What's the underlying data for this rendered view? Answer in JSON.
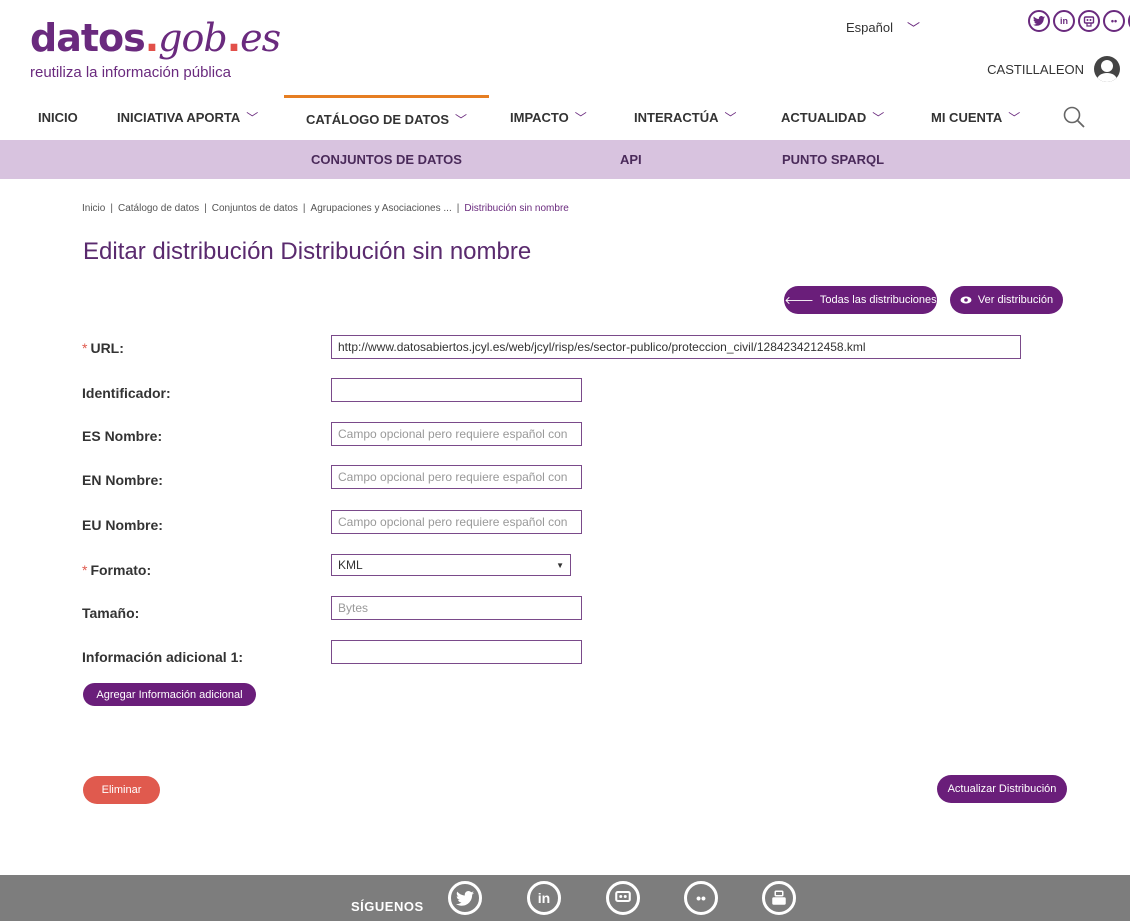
{
  "header": {
    "logo_main_a": "datos",
    "logo_main_dot": ".",
    "logo_main_b": "gob",
    "logo_main_dot2": ".",
    "logo_main_c": "es",
    "logo_sub": "reutiliza la información pública",
    "language": "Español",
    "username": "CASTILLALEON",
    "social_icons": [
      "twitter-icon",
      "linkedin-icon",
      "github-icon",
      "flickr-icon",
      "youtube-icon"
    ]
  },
  "nav": {
    "items": [
      {
        "label": "INICIO"
      },
      {
        "label": "INICIATIVA APORTA"
      },
      {
        "label": "CATÁLOGO DE DATOS"
      },
      {
        "label": "IMPACTO"
      },
      {
        "label": "INTERACTÚA"
      },
      {
        "label": "ACTUALIDAD"
      },
      {
        "label": "MI CUENTA"
      }
    ],
    "active_accent": "#e67e22",
    "subnav": [
      {
        "label": "CONJUNTOS DE DATOS"
      },
      {
        "label": "API"
      },
      {
        "label": "PUNTO SPARQL"
      }
    ]
  },
  "breadcrumb": {
    "items": [
      "Inicio",
      "Catálogo de datos",
      "Conjuntos de datos",
      "Agrupaciones y Asociaciones ..."
    ],
    "separator": "|",
    "current": "Distribución sin nombre"
  },
  "page": {
    "title": "Editar distribución Distribución sin nombre",
    "btn_all": "Todas las distribuciones",
    "btn_view": "Ver distribución"
  },
  "form": {
    "required_mark": "*",
    "url_label": "URL:",
    "url_value": "http://www.datosabiertos.jcyl.es/web/jcyl/risp/es/sector-publico/proteccion_civil/1284234212458.kml",
    "id_label": "Identificador:",
    "id_value": "",
    "es_label": "ES Nombre:",
    "en_label": "EN Nombre:",
    "eu_label": "EU Nombre:",
    "name_placeholder": "Campo opcional pero requiere español con",
    "format_label": "Formato:",
    "format_value": "KML",
    "size_label": "Tamaño:",
    "size_placeholder": "Bytes",
    "info_label": "Información adicional 1:",
    "info_value": "",
    "add_info_button": "Agregar Información adicional",
    "delete_button": "Eliminar",
    "update_button": "Actualizar Distribución"
  },
  "footer": {
    "follow_label": "SÍGUENOS",
    "social_icons": [
      "twitter-icon",
      "linkedin-icon",
      "github-icon",
      "flickr-icon",
      "youtube-icon"
    ]
  },
  "colors": {
    "brand_purple": "#6a1e7a",
    "subnav_bg": "#d8c3df",
    "danger": "#e05a4e",
    "footer_bg": "#7d7d7d"
  }
}
